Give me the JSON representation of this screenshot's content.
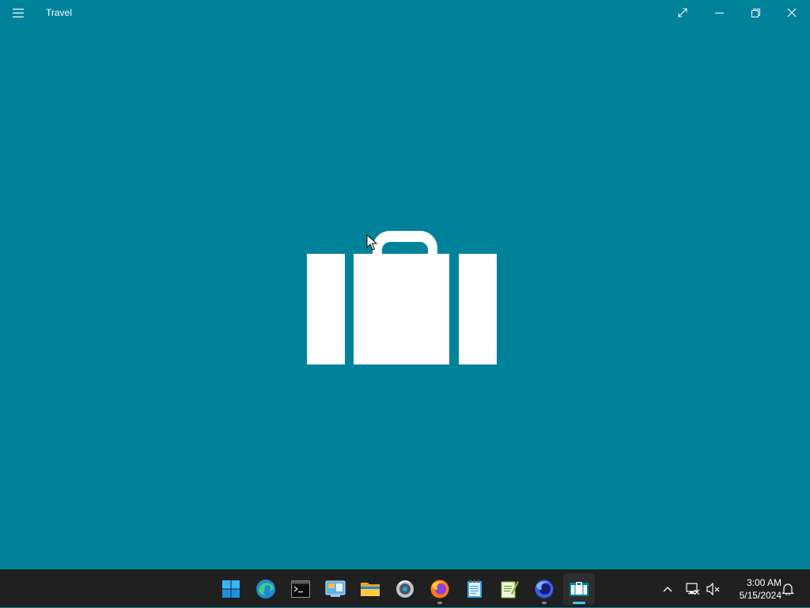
{
  "app": {
    "title": "Travel",
    "background": "#00829a",
    "splash_icon": "suitcase-icon"
  },
  "titlebar": {
    "menu_icon": "hamburger-icon",
    "buttons": [
      "full-screen-icon",
      "minimize-icon",
      "restore-icon",
      "close-icon"
    ]
  },
  "taskbar": {
    "background": "#202020",
    "apps": [
      {
        "name": "Start",
        "icon": "windows-start-icon"
      },
      {
        "name": "Microsoft Edge",
        "icon": "edge-icon"
      },
      {
        "name": "Terminal",
        "icon": "terminal-icon"
      },
      {
        "name": "Control Panel",
        "icon": "control-panel-icon"
      },
      {
        "name": "File Explorer",
        "icon": "folder-icon"
      },
      {
        "name": "Media Player",
        "icon": "media-player-icon"
      },
      {
        "name": "Firefox",
        "icon": "firefox-icon",
        "running": true
      },
      {
        "name": "Notepad",
        "icon": "notepad-icon"
      },
      {
        "name": "Notepad++",
        "icon": "notepadpp-icon"
      },
      {
        "name": "Firefox Nightly",
        "icon": "firefox-nightly-icon",
        "running": true
      },
      {
        "name": "Travel",
        "icon": "travel-icon",
        "running": true,
        "active": true
      }
    ],
    "tray": {
      "overflow_icon": "chevron-up-icon",
      "network_icon": "network-icon",
      "volume_icon": "volume-muted-icon",
      "notification_icon": "notification-bell-icon"
    },
    "clock": {
      "time": "3:00 AM",
      "date": "5/15/2024"
    }
  }
}
